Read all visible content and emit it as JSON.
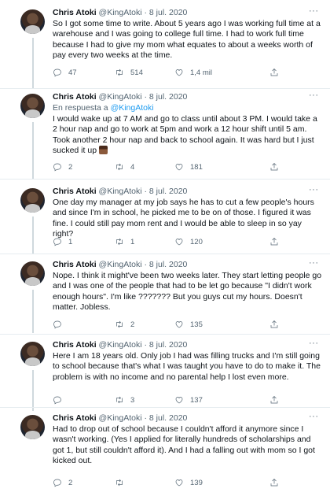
{
  "tweets": [
    {
      "name": "Chris Atoki",
      "handle": "@KingAtoki",
      "sep": "·",
      "date": "8 jul. 2020",
      "reply_prefix": "",
      "reply_mention": "",
      "text": "So I got some time to write. About 5 years ago I was working full time at a warehouse and I was going to college full time. I had to work full time because I had to give my mom what equates to about a weeks worth of pay every two weeks at the time.",
      "replies": "47",
      "retweets": "514",
      "likes": "1,4 mil"
    },
    {
      "name": "Chris Atoki",
      "handle": "@KingAtoki",
      "sep": "·",
      "date": "8 jul. 2020",
      "reply_prefix": "En respuesta a",
      "reply_mention": "@KingAtoki",
      "text": "I would wake up at 7 AM and go to class until about 3 PM. I would take a 2 hour nap and go to work at 5pm and work a 12 hour shift until 5 am. Took another 2 hour nap and back to school again. It was hard but I just sucked it up",
      "replies": "2",
      "retweets": "4",
      "likes": "181"
    },
    {
      "name": "Chris Atoki",
      "handle": "@KingAtoki",
      "sep": "·",
      "date": "8 jul. 2020",
      "reply_prefix": "",
      "reply_mention": "",
      "text": "One day my manager at my job says he has to cut a few people's hours and since I'm in school, he picked me to be on of those. I figured it was fine. I could still pay mom rent and I would be able to sleep in so yay right?",
      "replies": "1",
      "retweets": "1",
      "likes": "120"
    },
    {
      "name": "Chris Atoki",
      "handle": "@KingAtoki",
      "sep": "·",
      "date": "8 jul. 2020",
      "reply_prefix": "",
      "reply_mention": "",
      "text": "Nope. I think it might've been two weeks later. They start letting people go and I was one of the people that had to be let go because \"I didn't work enough hours\". I'm like ??????? But you guys cut my hours. Doesn't matter. Jobless.",
      "replies": "",
      "retweets": "2",
      "likes": "135"
    },
    {
      "name": "Chris Atoki",
      "handle": "@KingAtoki",
      "sep": "·",
      "date": "8 jul. 2020",
      "reply_prefix": "",
      "reply_mention": "",
      "text": "Here I am 18 years old. Only job I had was filling trucks and I'm still going to school because that's what I was taught you have to do to make it. The problem is with no income and no parental help I lost even more.",
      "replies": "",
      "retweets": "3",
      "likes": "137"
    },
    {
      "name": "Chris Atoki",
      "handle": "@KingAtoki",
      "sep": "·",
      "date": "8 jul. 2020",
      "reply_prefix": "",
      "reply_mention": "",
      "text": "Had to drop out of school because I couldn't afford it anymore since I wasn't working. (Yes I applied for literally hundreds of scholarships and got 1, but still couldn't afford it). And I had a falling out with mom so I got kicked out.",
      "replies": "2",
      "retweets": "",
      "likes": "139"
    }
  ],
  "more_glyph": "···",
  "icons": {
    "reply": "reply-icon",
    "retweet": "retweet-icon",
    "like": "like-icon",
    "share": "share-icon",
    "more": "more-icon"
  }
}
